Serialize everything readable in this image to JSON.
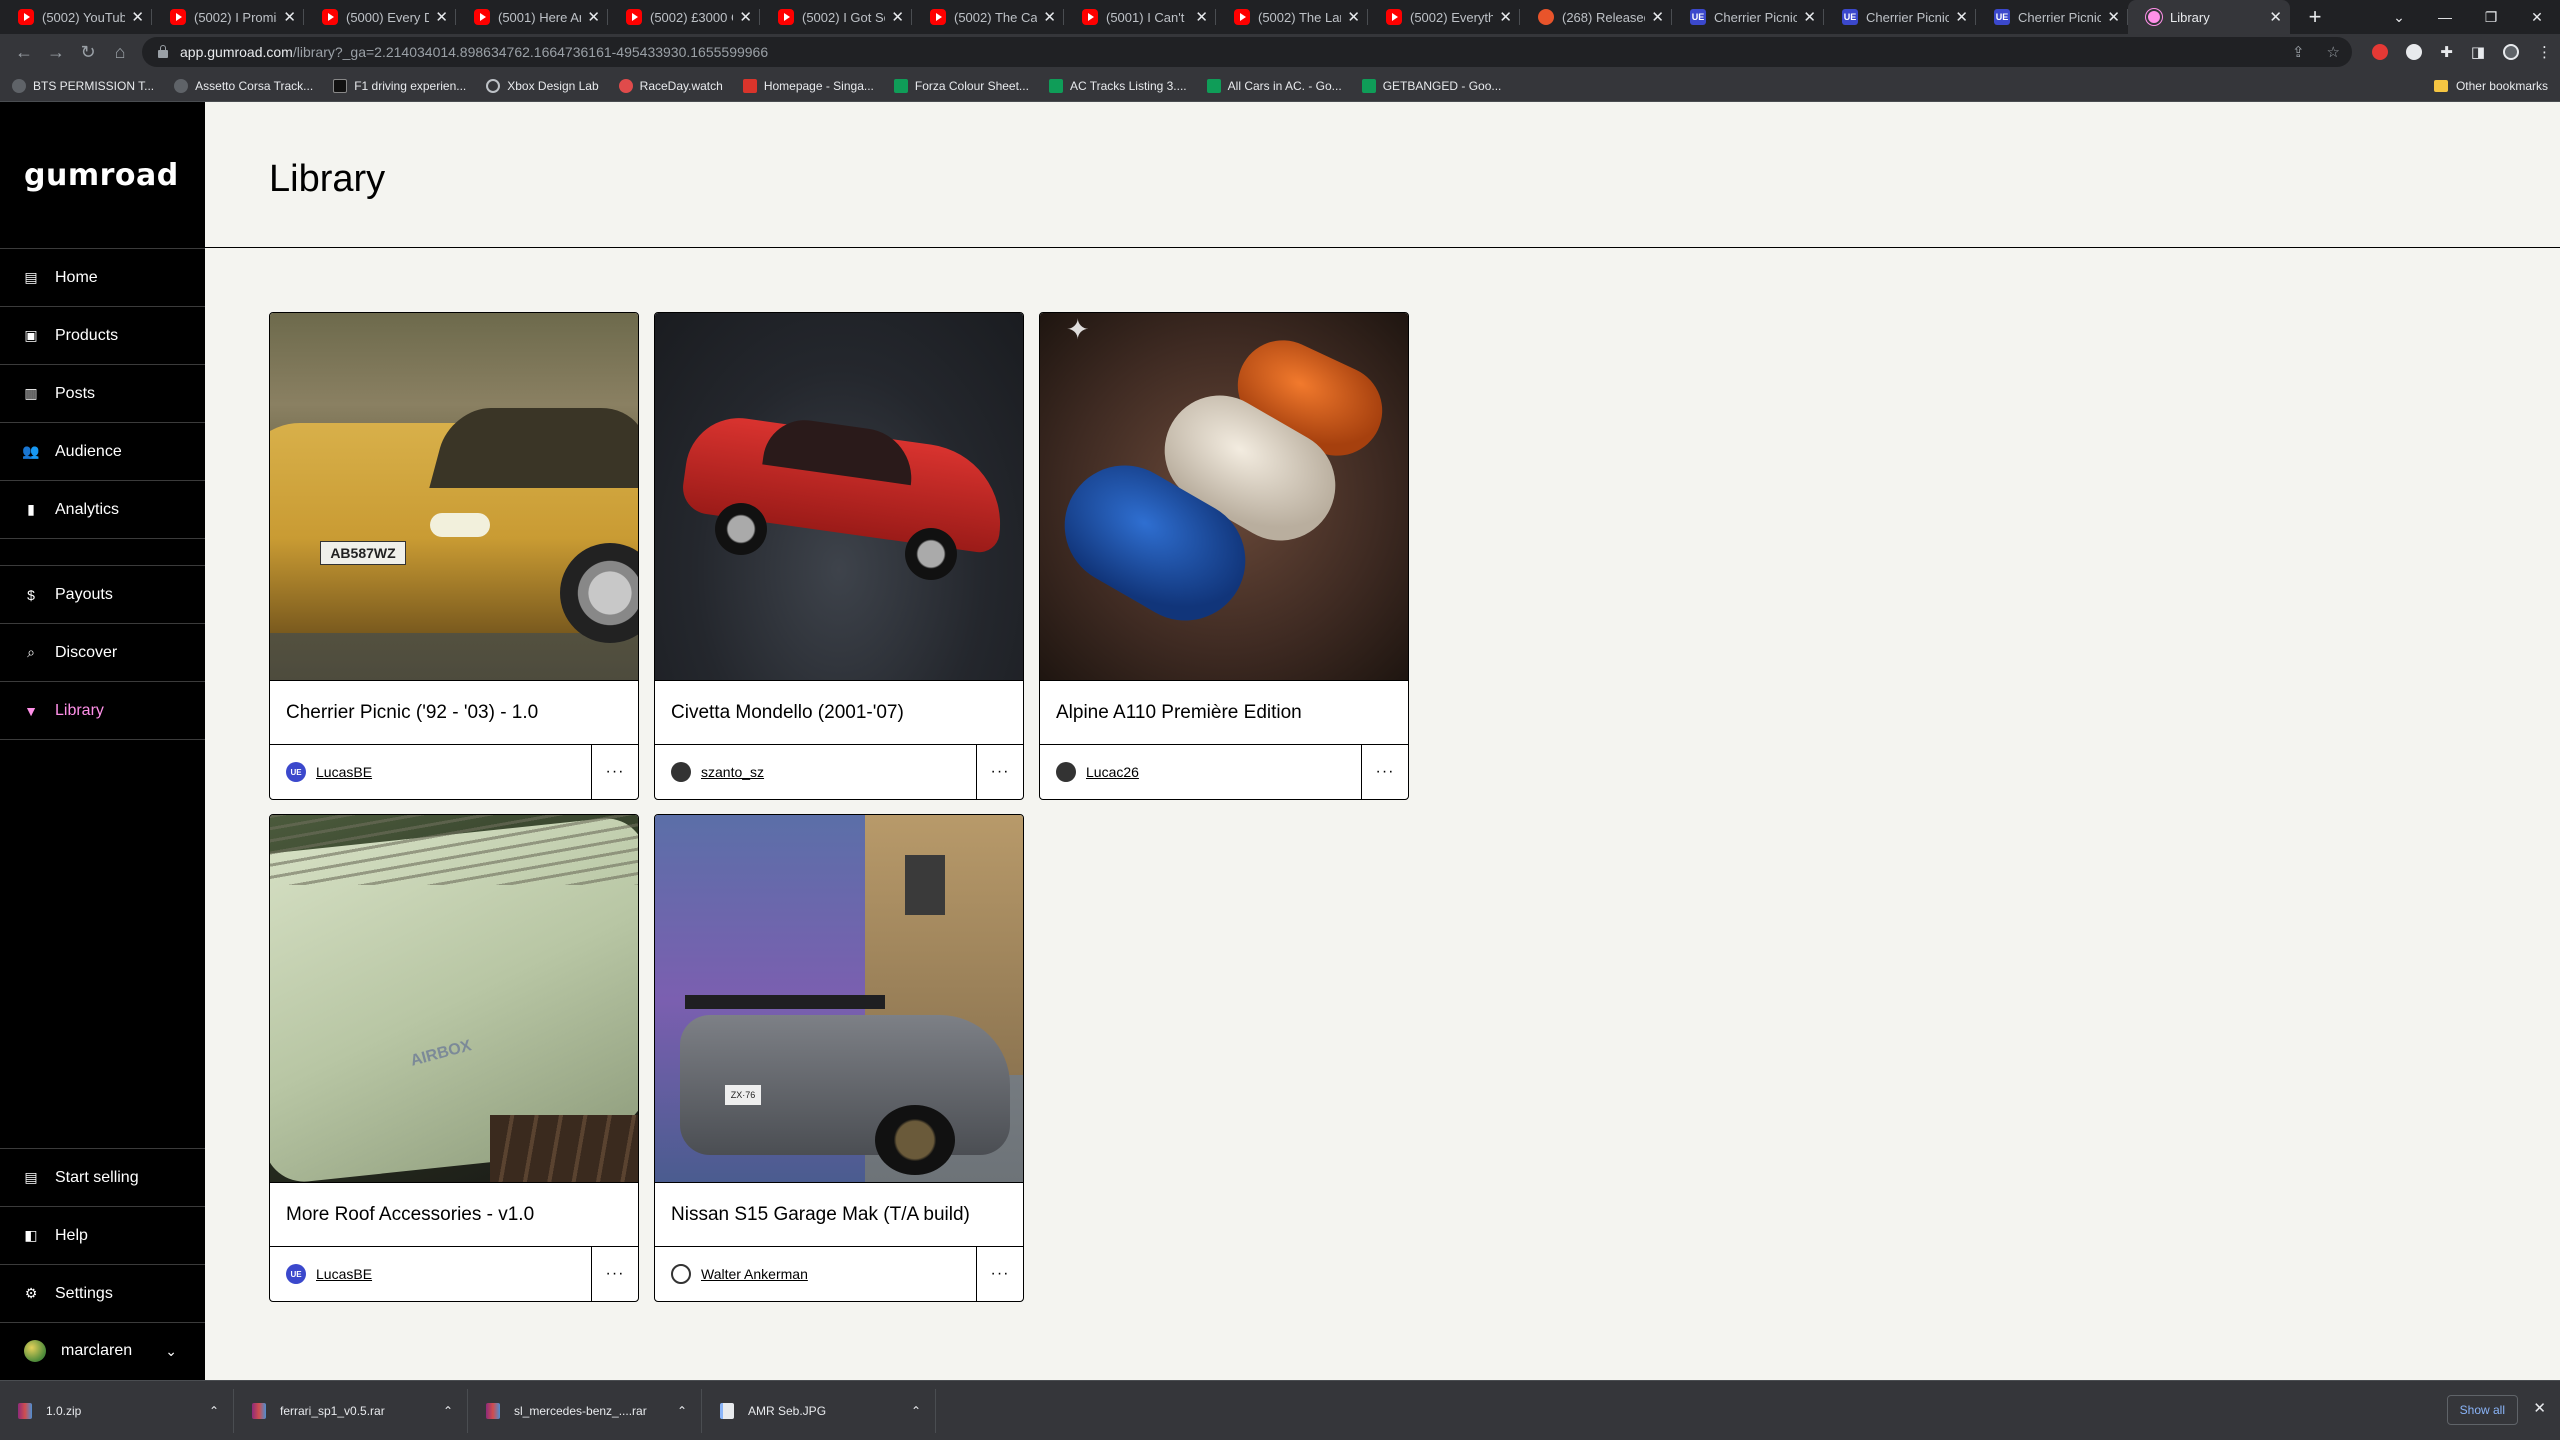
{
  "browser": {
    "tabs": [
      {
        "title": "(5002) YouTube",
        "icon": "youtube-icon",
        "kind": "yt"
      },
      {
        "title": "(5002) I Promise",
        "icon": "youtube-icon",
        "kind": "yt"
      },
      {
        "title": "(5000) Every Dri",
        "icon": "youtube-icon",
        "kind": "yt"
      },
      {
        "title": "(5001) Here Are",
        "icon": "youtube-icon",
        "kind": "yt"
      },
      {
        "title": "(5002) £3000 Ca",
        "icon": "youtube-icon",
        "kind": "yt"
      },
      {
        "title": "(5002) I Got Sca",
        "icon": "youtube-icon",
        "kind": "yt"
      },
      {
        "title": "(5002) The Carts",
        "icon": "youtube-icon",
        "kind": "yt"
      },
      {
        "title": "(5001) I Can't BE",
        "icon": "youtube-icon",
        "kind": "yt"
      },
      {
        "title": "(5002) The Larg",
        "icon": "youtube-icon",
        "kind": "yt"
      },
      {
        "title": "(5002) Everythin",
        "icon": "youtube-icon",
        "kind": "yt"
      },
      {
        "title": "(268) Released",
        "icon": "released-icon",
        "kind": "rel"
      },
      {
        "title": "Cherrier Picnic (",
        "icon": "ue-icon",
        "kind": "ue"
      },
      {
        "title": "Cherrier Picnic (",
        "icon": "ue-icon",
        "kind": "ue"
      },
      {
        "title": "Cherrier Picnic (",
        "icon": "ue-icon",
        "kind": "ue"
      },
      {
        "title": "Library",
        "icon": "gumroad-icon",
        "kind": "gr",
        "active": true
      }
    ],
    "url_host": "app.gumroad.com",
    "url_path": "/library?_ga=2.214034014.898634762.1664736161-495433930.1655599966",
    "bookmarks": [
      {
        "label": "BTS PERMISSION T...",
        "icon": "dark"
      },
      {
        "label": "Assetto Corsa Track...",
        "icon": "dark"
      },
      {
        "label": "F1 driving experien...",
        "icon": "f1"
      },
      {
        "label": "Xbox Design Lab",
        "icon": "globe"
      },
      {
        "label": "RaceDay.watch",
        "icon": "rd"
      },
      {
        "label": "Homepage - Singa...",
        "icon": "sp"
      },
      {
        "label": "Forza Colour Sheet...",
        "icon": "sheet"
      },
      {
        "label": "AC Tracks Listing 3....",
        "icon": "sheet"
      },
      {
        "label": "All Cars in AC. - Go...",
        "icon": "sheet"
      },
      {
        "label": "GETBANGED - Goo...",
        "icon": "sheet"
      }
    ],
    "other_bookmarks": "Other bookmarks"
  },
  "sidebar": {
    "logo": "Gumroad",
    "nav_top": [
      {
        "label": "Home",
        "icon": "home-icon",
        "glyph": "▤"
      },
      {
        "label": "Products",
        "icon": "products-icon",
        "glyph": "▣"
      },
      {
        "label": "Posts",
        "icon": "posts-icon",
        "glyph": "▥"
      },
      {
        "label": "Audience",
        "icon": "audience-icon",
        "glyph": "👥"
      },
      {
        "label": "Analytics",
        "icon": "analytics-icon",
        "glyph": "▮"
      }
    ],
    "nav_mid": [
      {
        "label": "Payouts",
        "icon": "payouts-icon",
        "glyph": "$"
      },
      {
        "label": "Discover",
        "icon": "search-icon",
        "glyph": "⌕"
      },
      {
        "label": "Library",
        "icon": "bookmark-icon",
        "glyph": "▼",
        "active": true
      }
    ],
    "nav_bottom": [
      {
        "label": "Start selling",
        "icon": "store-icon",
        "glyph": "▤"
      },
      {
        "label": "Help",
        "icon": "help-icon",
        "glyph": "◧"
      },
      {
        "label": "Settings",
        "icon": "gear-icon",
        "glyph": "⚙"
      }
    ],
    "user": "marclaren"
  },
  "main": {
    "title": "Library",
    "products": [
      {
        "title": "Cherrier Picnic ('92 - '03) - 1.0",
        "creator": "LucasBE",
        "avatar": "ue",
        "thumb": "t1"
      },
      {
        "title": "Civetta Mondello (2001-'07)",
        "creator": "szanto_sz",
        "avatar": "dark",
        "thumb": "t2"
      },
      {
        "title": "Alpine A110 Première Edition",
        "creator": "Lucac26",
        "avatar": "dark",
        "thumb": "t3"
      },
      {
        "title": "More Roof Accessories - v1.0",
        "creator": "LucasBE",
        "avatar": "ue",
        "thumb": "t4"
      },
      {
        "title": "Nissan S15 Garage Mak (T/A build)",
        "creator": "Walter Ankerman",
        "avatar": "wa",
        "thumb": "t5"
      }
    ],
    "plate_1": "AB587WZ",
    "plate_5": "ZX·76",
    "roof_logo": "AIRBOX"
  },
  "downloads": {
    "items": [
      {
        "name": "1.0.zip",
        "kind": "rar"
      },
      {
        "name": "ferrari_sp1_v0.5.rar",
        "kind": "rar"
      },
      {
        "name": "sl_mercedes-benz_....rar",
        "kind": "rar"
      },
      {
        "name": "AMR Seb.JPG",
        "kind": "img"
      }
    ],
    "show_all": "Show all"
  }
}
